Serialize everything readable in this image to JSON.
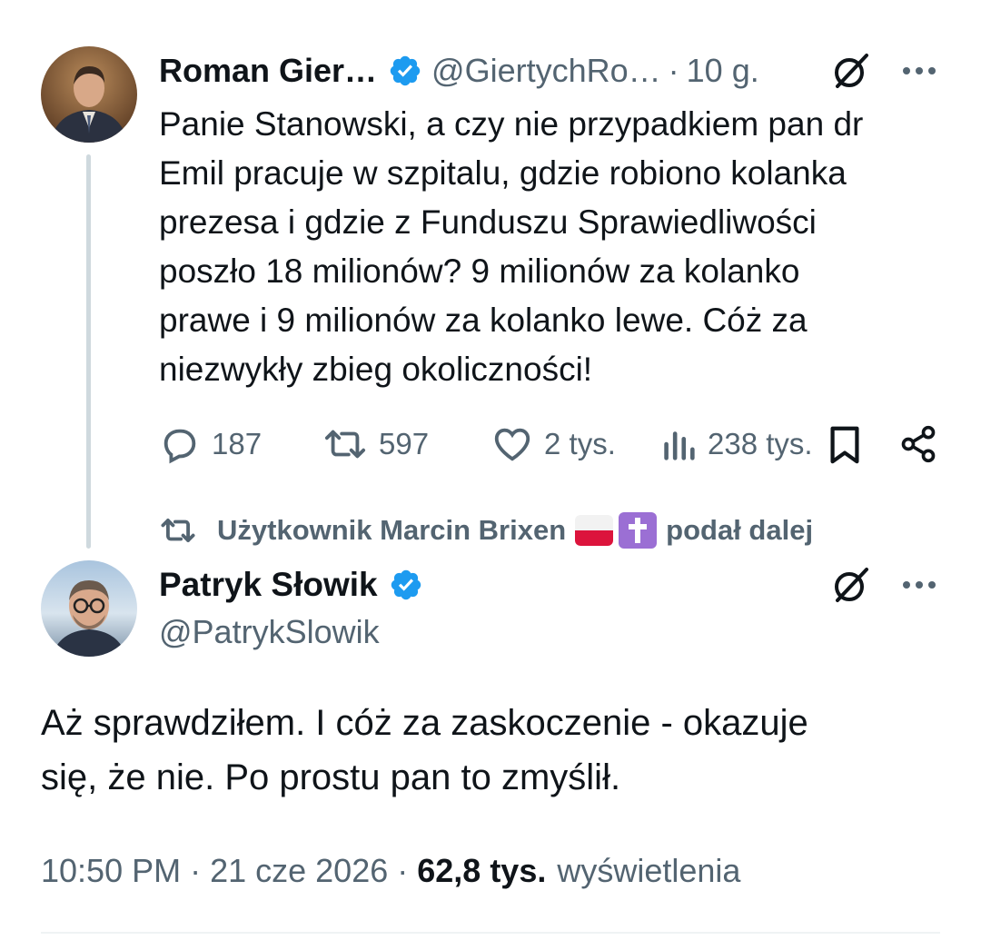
{
  "parent_tweet": {
    "author_name": "Roman Gier…",
    "handle": "@GiertychRo…",
    "separator": "·",
    "time": "10 g.",
    "text": "Panie Stanowski, a czy nie przypadkiem pan dr\nEmil pracuje w szpitalu, gdzie robiono kolanka\nprezesa i gdzie z Funduszu Sprawiedliwości\nposzło 18 milionów? 9 milionów za kolanko\nprawe i 9 milionów za kolanko lewe. Cóż za\nniezwykły zbieg okoliczności!",
    "actions": {
      "replies": "187",
      "reposts": "597",
      "likes": "2 tys.",
      "views": "238 tys."
    }
  },
  "repost_line": {
    "text": "Użytkownik Marcin Brixen",
    "suffix": "podał dalej"
  },
  "main_tweet": {
    "author_name": "Patryk Słowik",
    "handle": "@PatrykSlowik",
    "text": "Aż sprawdziłem. I cóż za zaskoczenie - okazuje\nsię, że nie. Po prostu pan to zmyślił.",
    "time": "10:50 PM",
    "separator": "·",
    "date": "21 cze 2026",
    "views_count": "62,8 tys.",
    "views_label": "wyświetlenia"
  },
  "colors": {
    "text_primary": "#0f1419",
    "text_secondary": "#536471",
    "verified_blue": "#1d9bf0",
    "thread_line": "#cfd9de",
    "divider": "#eff3f4"
  },
  "icons": [
    "verified-badge-icon",
    "grok-icon",
    "more-icon",
    "reply-icon",
    "repost-icon",
    "like-icon",
    "views-icon",
    "bookmark-icon",
    "share-icon",
    "poland-flag-emoji",
    "latin-cross-emoji"
  ]
}
